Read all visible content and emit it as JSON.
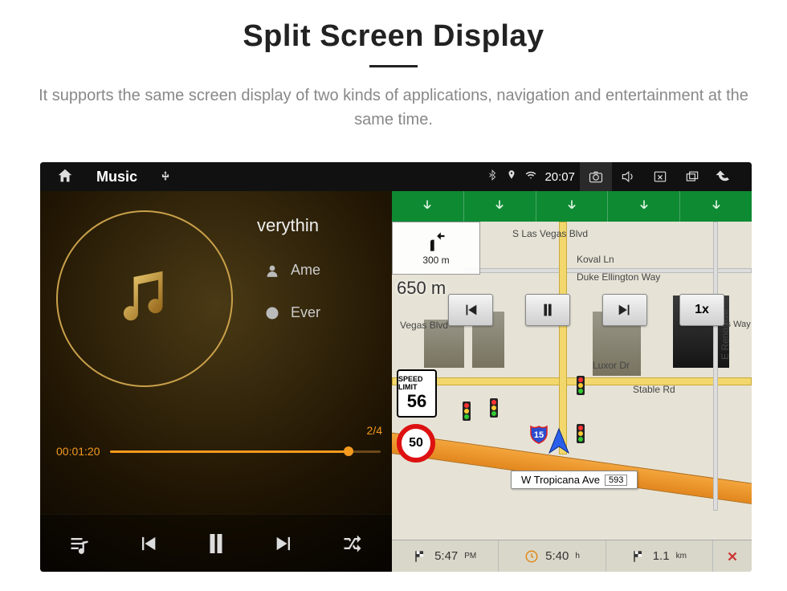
{
  "page": {
    "title": "Split Screen Display",
    "subtitle": "It supports the same screen display of two kinds of applications, navigation and entertainment at the same time."
  },
  "statusbar": {
    "app_label": "Music",
    "time": "20:07",
    "icons": {
      "home": "home-icon",
      "usb": "usb-icon",
      "bt": "bluetooth-icon",
      "gps": "gps-pin-icon",
      "wifi": "wifi-icon",
      "camera": "camera-icon",
      "volume": "volume-icon",
      "close": "close-window-icon",
      "recents": "recents-icon",
      "back": "back-icon"
    }
  },
  "music": {
    "track_title": "verythin",
    "artist": "Ame",
    "album": "Ever",
    "track_index": "2/4",
    "elapsed": "00:01:20",
    "progress_pct": 88,
    "controls": {
      "playlist": "playlist-icon",
      "prev": "previous-track-icon",
      "playpause": "pause-icon",
      "next": "next-track-icon",
      "shuffle": "shuffle-icon"
    }
  },
  "nav": {
    "lane_count": 5,
    "lanes": [
      "down-arrow",
      "down-arrow",
      "down-arrow",
      "down-arrow",
      "down-arrow"
    ],
    "turn": {
      "direction": "left",
      "step_dist": "300 m",
      "main_dist": "650 m"
    },
    "speed_limit_label": "SPEED LIMIT",
    "speed_limit": "56",
    "current_speed": "50",
    "highway_shield": "15",
    "streets": {
      "s_las_vegas": "S Las Vegas Blvd",
      "koval": "Koval Ln",
      "duke": "Duke Ellington Way",
      "vegas_blvd2": "Vegas Blvd",
      "luxor": "Luxor Dr",
      "stable": "Stable Rd",
      "reno": "E Reno Ave",
      "tropicana": "W Tropicana Ave",
      "tropicana_num": "593",
      "les": "les Way"
    },
    "overlay": {
      "prev": "⏮",
      "pause": "⏸",
      "next": "⏭",
      "speed": "1x"
    },
    "bottom": {
      "eta": "5:47",
      "eta_unit": "PM",
      "duration": "5:40",
      "duration_unit": "h",
      "distance": "1.1",
      "distance_unit": "km"
    }
  }
}
